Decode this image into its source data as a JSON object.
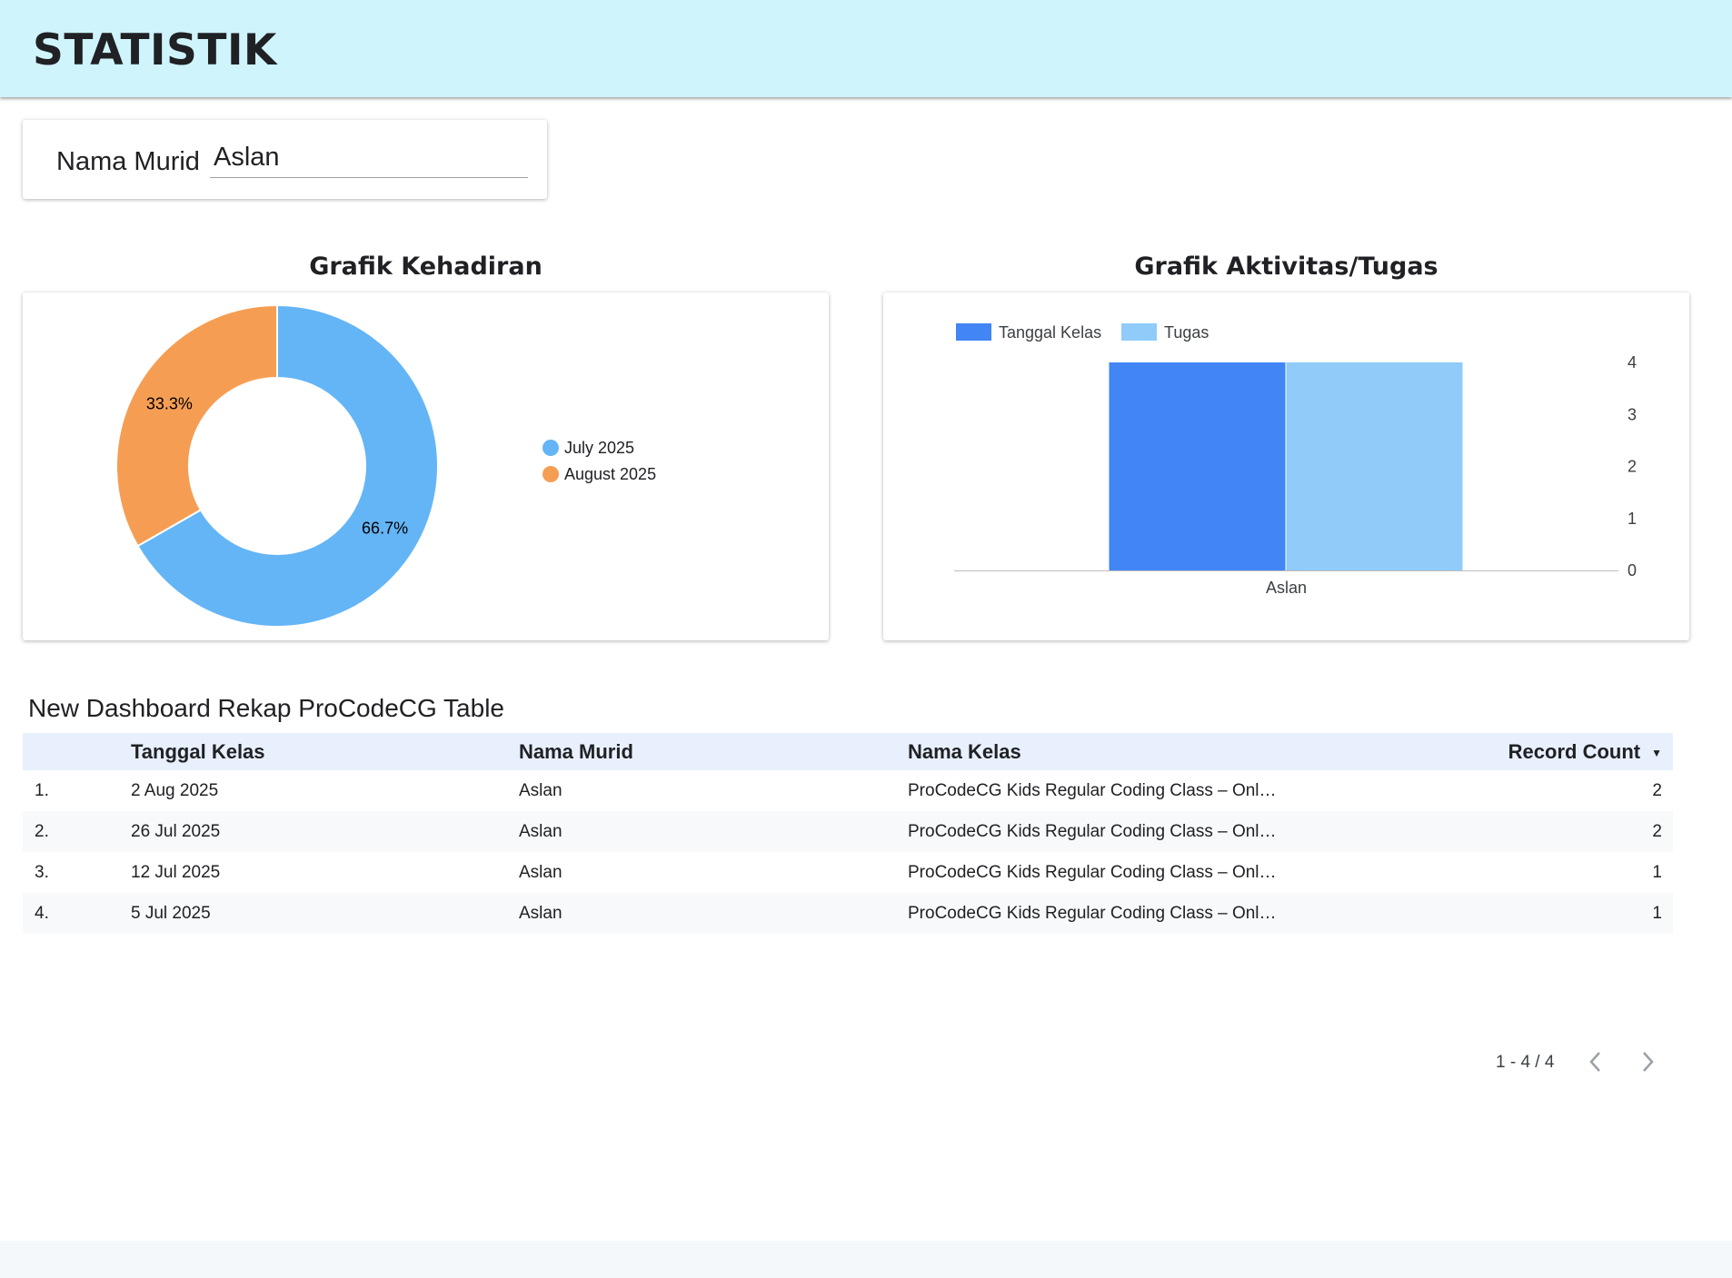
{
  "header": {
    "title": "STATISTIK"
  },
  "filter": {
    "label": "Nama Murid",
    "value": "Aslan"
  },
  "pie_chart": {
    "title": "Grafik Kehadiran",
    "chart_data": {
      "type": "pie",
      "donut": true,
      "categories": [
        "July 2025",
        "August 2025"
      ],
      "values": [
        66.7,
        33.3
      ],
      "value_labels": [
        "66.7%",
        "33.3%"
      ],
      "colors": [
        "#64b5f6",
        "#f59e53"
      ],
      "legend_position": "right"
    }
  },
  "bar_chart": {
    "title": "Grafik Aktivitas/Tugas",
    "chart_data": {
      "type": "bar",
      "categories": [
        "Aslan"
      ],
      "series": [
        {
          "name": "Tanggal Kelas",
          "values": [
            4
          ],
          "color": "#4285f4"
        },
        {
          "name": "Tugas",
          "values": [
            4
          ],
          "color": "#90cbf9"
        }
      ],
      "y_ticks": [
        "0",
        "1",
        "2",
        "3",
        "4"
      ],
      "ylim": [
        0,
        4
      ],
      "y_axis_side": "right",
      "legend_position": "top-left"
    }
  },
  "table": {
    "title": "New Dashboard Rekap ProCodeCG Table",
    "columns": [
      "Tanggal Kelas",
      "Nama Murid",
      "Nama Kelas",
      "Record Count"
    ],
    "rows": [
      {
        "idx": "1.",
        "tanggal": "2 Aug 2025",
        "nama": "Aslan",
        "kelas": "ProCodeCG Kids Regular Coding Class – Onl…",
        "count": "2"
      },
      {
        "idx": "2.",
        "tanggal": "26 Jul 2025",
        "nama": "Aslan",
        "kelas": "ProCodeCG Kids Regular Coding Class – Onl…",
        "count": "2"
      },
      {
        "idx": "3.",
        "tanggal": "12 Jul 2025",
        "nama": "Aslan",
        "kelas": "ProCodeCG Kids Regular Coding Class – Onl…",
        "count": "1"
      },
      {
        "idx": "4.",
        "tanggal": "5 Jul 2025",
        "nama": "Aslan",
        "kelas": "ProCodeCG Kids Regular Coding Class – Onl…",
        "count": "1"
      }
    ],
    "pagination": "1 - 4 / 4",
    "sort_icon": "sort-desc-icon",
    "prev_icon": "chevron-left-icon",
    "next_icon": "chevron-right-icon"
  }
}
